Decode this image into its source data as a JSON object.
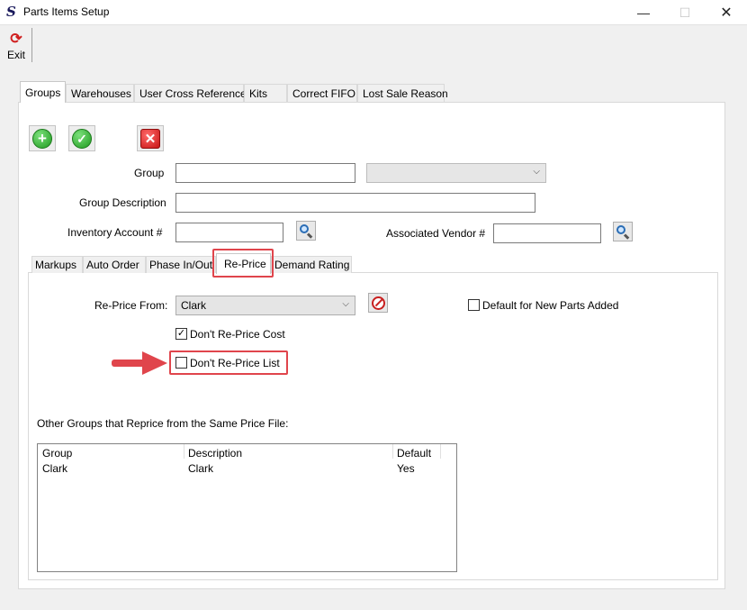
{
  "window": {
    "title": "Parts Items Setup",
    "app_icon_glyph": "S",
    "minimize_glyph": "—",
    "maximize_glyph": "☐",
    "close_glyph": "✕"
  },
  "toolbar": {
    "exit_label": "Exit",
    "exit_icon": "exit-icon"
  },
  "outer_tabs": [
    "Groups",
    "Warehouses",
    "User Cross Reference",
    "Kits",
    "Correct FIFO",
    "Lost Sale Reason"
  ],
  "outer_active_tab": "Groups",
  "actions": {
    "add_icon_glyph": "+",
    "save_icon_glyph": "✓",
    "delete_icon_glyph": "✕"
  },
  "form": {
    "group_label": "Group",
    "group_value": "",
    "group_combo_value": "",
    "group_description_label": "Group Description",
    "group_description_value": "",
    "inventory_account_label": "Inventory Account #",
    "inventory_account_value": "",
    "associated_vendor_label": "Associated Vendor #",
    "associated_vendor_value": ""
  },
  "inner_tabs": [
    "Markups",
    "Auto Order",
    "Phase In/Out",
    "Re-Price",
    "Demand Rating"
  ],
  "inner_active_tab": "Re-Price",
  "reprice": {
    "reprice_from_label": "Re-Price From:",
    "reprice_from_value": "Clark",
    "default_new_parts_label": "Default for New Parts Added",
    "default_new_parts_checked": false,
    "dont_reprice_cost_label": "Don't Re-Price Cost",
    "dont_reprice_cost_checked": true,
    "dont_reprice_list_label": "Don't Re-Price List",
    "dont_reprice_list_checked": false,
    "check_glyph": "✓",
    "other_groups_label": "Other Groups that Reprice from the Same Price File:"
  },
  "grid": {
    "columns": [
      "Group",
      "Description",
      "Default"
    ],
    "rows": [
      [
        "Clark",
        "Clark",
        "Yes"
      ]
    ]
  },
  "colors": {
    "highlight": "#e0454c",
    "tab_border": "#d9d9d9"
  }
}
